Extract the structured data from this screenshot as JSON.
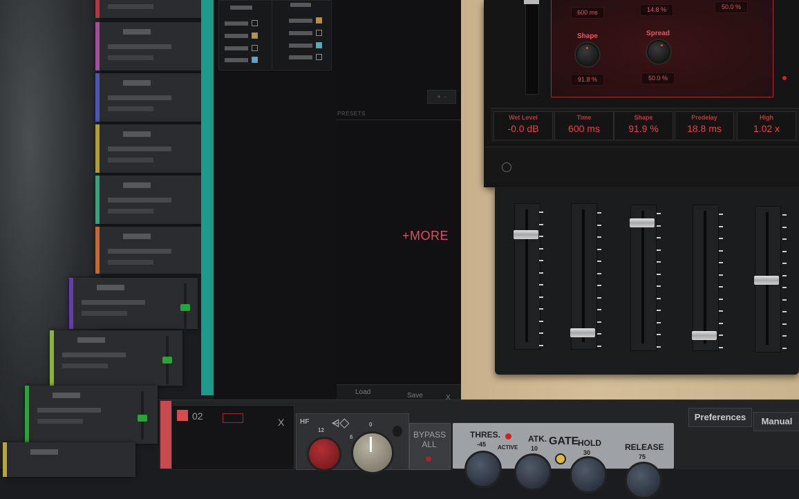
{
  "more_link": "+MORE",
  "reverb": {
    "top_values": [
      "600 ms",
      "14.8 %",
      "50.0 %"
    ],
    "knobs": [
      {
        "label": "Shape",
        "value": "91.8 %"
      },
      {
        "label": "Spread",
        "value": "50.0 %"
      }
    ],
    "params": [
      {
        "label": "Wet Level",
        "value": "-0.0 dB"
      },
      {
        "label": "Time",
        "value": "600 ms"
      },
      {
        "label": "Shape",
        "value": "91.9 %"
      },
      {
        "label": "Predelay",
        "value": "18.8 ms"
      },
      {
        "label": "High",
        "value": "1.02 x"
      }
    ]
  },
  "eq_sliders": {
    "levels": [
      0.8,
      0.06,
      0.9,
      0.05,
      0.48
    ]
  },
  "presets": {
    "header": "PRESETS",
    "load_label": "Load",
    "save_label": "Save",
    "close_label": "X"
  },
  "bottom_bar": {
    "preferences_label": "Preferences",
    "manual_label": "Manual",
    "track_name": "02",
    "track_close": "X",
    "hf_label": "HF",
    "bypass_label": "BYPASS\nALL",
    "thres_label": "THRES.",
    "thres_value": "-45",
    "active_label": "ACTIVE",
    "atk_label": "ATK.",
    "atk_value": "10",
    "gate_label": "GATE",
    "hold_label": "HOLD",
    "hold_value": "30",
    "release_label": "RELEASE",
    "release_value": "75",
    "scale_12": "12",
    "scale_0": "0",
    "scale_6": "6"
  },
  "colors": {
    "accent_red": "#ec3f45",
    "more_pink": "#e84a65",
    "teal": "#1e9a8c"
  }
}
